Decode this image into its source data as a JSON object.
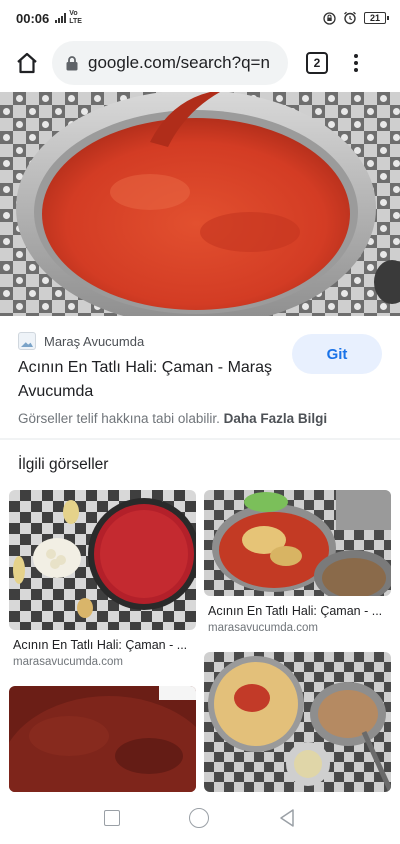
{
  "status_bar": {
    "time": "00:06",
    "network_top": "VoLTE",
    "network_label": "Vo",
    "network_label2": "LTE",
    "battery": "21"
  },
  "browser": {
    "url": "google.com/search?q=n",
    "tab_count": "2"
  },
  "result": {
    "source": "Maraş Avucumda",
    "title": "Acının En Tatlı Hali: Çaman - Maraş Avucumda",
    "visit_label": "Git",
    "copyright_text": "Görseller telif hakkına tabi olabilir.",
    "more_info_link": "Daha Fazla Bilgi"
  },
  "related": {
    "heading": "İlgili görseller",
    "items": [
      {
        "title": "Acının En Tatlı Hali: Çaman - ...",
        "site": "marasavucumda.com"
      },
      {
        "title": "Acının En Tatlı Hali: Çaman - ...",
        "site": "marasavucumda.com"
      },
      {
        "title": "",
        "site": ""
      },
      {
        "title": "",
        "site": ""
      }
    ]
  },
  "colors": {
    "accent": "#1a73e8",
    "button_bg": "#e8f0fe",
    "sauce": "#d9412a"
  }
}
